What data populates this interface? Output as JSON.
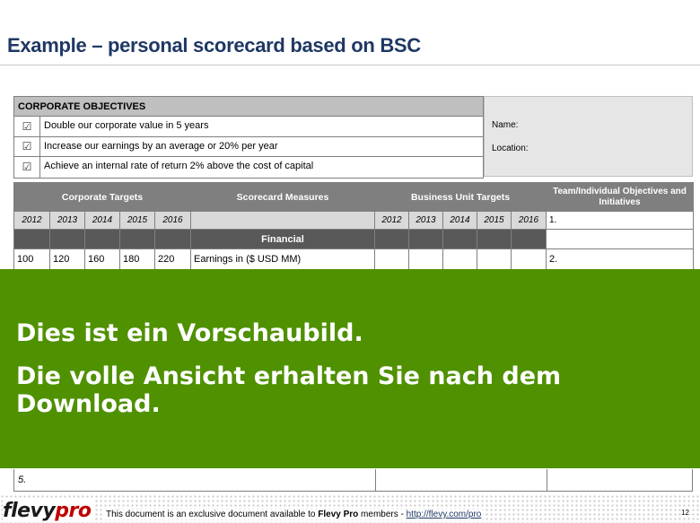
{
  "title": "Example – personal scorecard based on BSC",
  "objectives": {
    "header": "CORPORATE OBJECTIVES",
    "check_symbol": "☑",
    "items": [
      "Double our corporate value in 5 years",
      "Increase our earnings by an average or 20% per year",
      "Achieve an internal rate of return 2% above the cost of capital"
    ]
  },
  "info": {
    "name_label": "Name:",
    "location_label": "Location:"
  },
  "table": {
    "headers": {
      "corporate_targets": "Corporate Targets",
      "scorecard_measures": "Scorecard Measures",
      "business_unit_targets": "Business Unit Targets",
      "team_objectives": "Team/Individual Objectives and Initiatives"
    },
    "years": [
      "2012",
      "2013",
      "2014",
      "2015",
      "2016"
    ],
    "first_item": "1.",
    "section_financial": "Financial",
    "row1": {
      "values": [
        "100",
        "120",
        "160",
        "180",
        "220"
      ],
      "measure": "Earnings in ($ USD MM)",
      "item": "2."
    },
    "last_item": "5."
  },
  "banner": {
    "line1": "Dies ist ein Vorschaubild.",
    "line2": "Die volle Ansicht erhalten Sie nach dem Download."
  },
  "footer": {
    "logo_main": "flevy",
    "logo_accent": "pro",
    "text_prefix": "This document is an exclusive document available to ",
    "text_brand": "Flevy Pro",
    "text_mid": " members - ",
    "link": "http://flevy.com/pro",
    "page": "12"
  },
  "colors": {
    "title": "#1f3864",
    "banner": "#4f9100",
    "header_gray": "#7f7f7f",
    "section_dark": "#595959"
  }
}
